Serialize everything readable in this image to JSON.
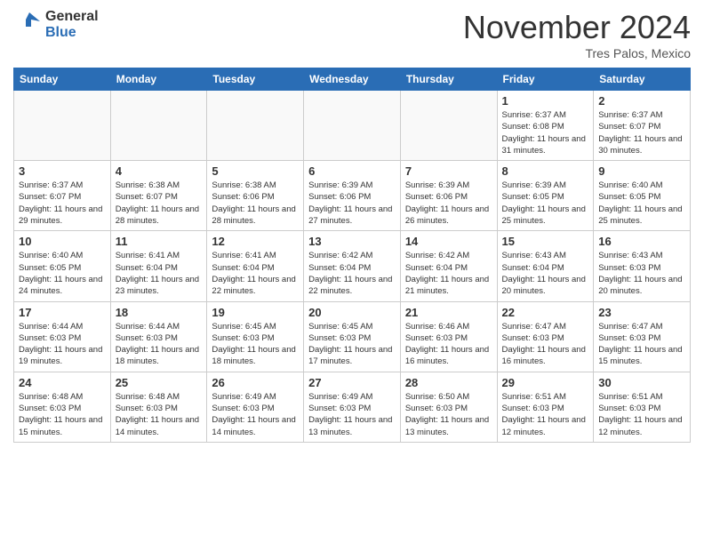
{
  "header": {
    "logo_general": "General",
    "logo_blue": "Blue",
    "month_title": "November 2024",
    "location": "Tres Palos, Mexico"
  },
  "columns": [
    "Sunday",
    "Monday",
    "Tuesday",
    "Wednesday",
    "Thursday",
    "Friday",
    "Saturday"
  ],
  "weeks": [
    [
      {
        "day": "",
        "info": ""
      },
      {
        "day": "",
        "info": ""
      },
      {
        "day": "",
        "info": ""
      },
      {
        "day": "",
        "info": ""
      },
      {
        "day": "",
        "info": ""
      },
      {
        "day": "1",
        "info": "Sunrise: 6:37 AM\nSunset: 6:08 PM\nDaylight: 11 hours and 31 minutes."
      },
      {
        "day": "2",
        "info": "Sunrise: 6:37 AM\nSunset: 6:07 PM\nDaylight: 11 hours and 30 minutes."
      }
    ],
    [
      {
        "day": "3",
        "info": "Sunrise: 6:37 AM\nSunset: 6:07 PM\nDaylight: 11 hours and 29 minutes."
      },
      {
        "day": "4",
        "info": "Sunrise: 6:38 AM\nSunset: 6:07 PM\nDaylight: 11 hours and 28 minutes."
      },
      {
        "day": "5",
        "info": "Sunrise: 6:38 AM\nSunset: 6:06 PM\nDaylight: 11 hours and 28 minutes."
      },
      {
        "day": "6",
        "info": "Sunrise: 6:39 AM\nSunset: 6:06 PM\nDaylight: 11 hours and 27 minutes."
      },
      {
        "day": "7",
        "info": "Sunrise: 6:39 AM\nSunset: 6:06 PM\nDaylight: 11 hours and 26 minutes."
      },
      {
        "day": "8",
        "info": "Sunrise: 6:39 AM\nSunset: 6:05 PM\nDaylight: 11 hours and 25 minutes."
      },
      {
        "day": "9",
        "info": "Sunrise: 6:40 AM\nSunset: 6:05 PM\nDaylight: 11 hours and 25 minutes."
      }
    ],
    [
      {
        "day": "10",
        "info": "Sunrise: 6:40 AM\nSunset: 6:05 PM\nDaylight: 11 hours and 24 minutes."
      },
      {
        "day": "11",
        "info": "Sunrise: 6:41 AM\nSunset: 6:04 PM\nDaylight: 11 hours and 23 minutes."
      },
      {
        "day": "12",
        "info": "Sunrise: 6:41 AM\nSunset: 6:04 PM\nDaylight: 11 hours and 22 minutes."
      },
      {
        "day": "13",
        "info": "Sunrise: 6:42 AM\nSunset: 6:04 PM\nDaylight: 11 hours and 22 minutes."
      },
      {
        "day": "14",
        "info": "Sunrise: 6:42 AM\nSunset: 6:04 PM\nDaylight: 11 hours and 21 minutes."
      },
      {
        "day": "15",
        "info": "Sunrise: 6:43 AM\nSunset: 6:04 PM\nDaylight: 11 hours and 20 minutes."
      },
      {
        "day": "16",
        "info": "Sunrise: 6:43 AM\nSunset: 6:03 PM\nDaylight: 11 hours and 20 minutes."
      }
    ],
    [
      {
        "day": "17",
        "info": "Sunrise: 6:44 AM\nSunset: 6:03 PM\nDaylight: 11 hours and 19 minutes."
      },
      {
        "day": "18",
        "info": "Sunrise: 6:44 AM\nSunset: 6:03 PM\nDaylight: 11 hours and 18 minutes."
      },
      {
        "day": "19",
        "info": "Sunrise: 6:45 AM\nSunset: 6:03 PM\nDaylight: 11 hours and 18 minutes."
      },
      {
        "day": "20",
        "info": "Sunrise: 6:45 AM\nSunset: 6:03 PM\nDaylight: 11 hours and 17 minutes."
      },
      {
        "day": "21",
        "info": "Sunrise: 6:46 AM\nSunset: 6:03 PM\nDaylight: 11 hours and 16 minutes."
      },
      {
        "day": "22",
        "info": "Sunrise: 6:47 AM\nSunset: 6:03 PM\nDaylight: 11 hours and 16 minutes."
      },
      {
        "day": "23",
        "info": "Sunrise: 6:47 AM\nSunset: 6:03 PM\nDaylight: 11 hours and 15 minutes."
      }
    ],
    [
      {
        "day": "24",
        "info": "Sunrise: 6:48 AM\nSunset: 6:03 PM\nDaylight: 11 hours and 15 minutes."
      },
      {
        "day": "25",
        "info": "Sunrise: 6:48 AM\nSunset: 6:03 PM\nDaylight: 11 hours and 14 minutes."
      },
      {
        "day": "26",
        "info": "Sunrise: 6:49 AM\nSunset: 6:03 PM\nDaylight: 11 hours and 14 minutes."
      },
      {
        "day": "27",
        "info": "Sunrise: 6:49 AM\nSunset: 6:03 PM\nDaylight: 11 hours and 13 minutes."
      },
      {
        "day": "28",
        "info": "Sunrise: 6:50 AM\nSunset: 6:03 PM\nDaylight: 11 hours and 13 minutes."
      },
      {
        "day": "29",
        "info": "Sunrise: 6:51 AM\nSunset: 6:03 PM\nDaylight: 11 hours and 12 minutes."
      },
      {
        "day": "30",
        "info": "Sunrise: 6:51 AM\nSunset: 6:03 PM\nDaylight: 11 hours and 12 minutes."
      }
    ]
  ]
}
